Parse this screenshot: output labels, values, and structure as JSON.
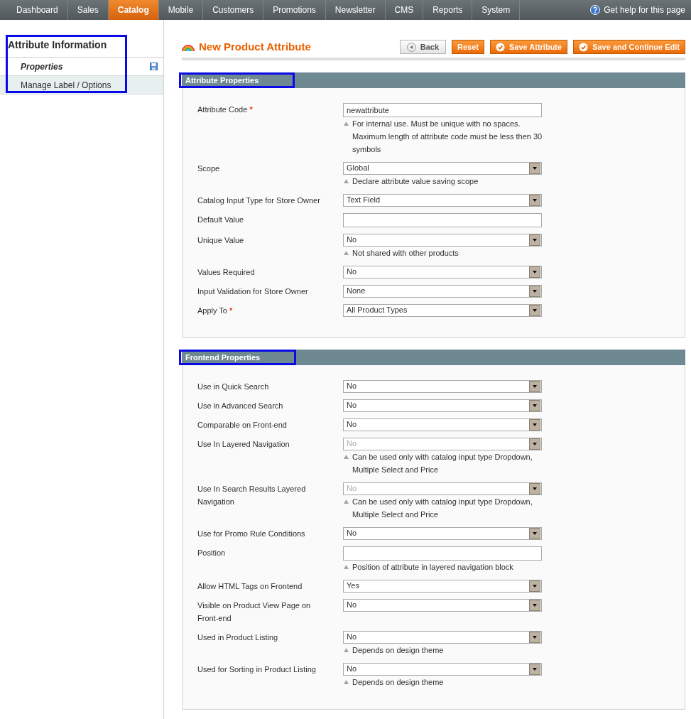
{
  "nav": {
    "items": [
      {
        "label": "Dashboard",
        "selected": false
      },
      {
        "label": "Sales",
        "selected": false
      },
      {
        "label": "Catalog",
        "selected": true
      },
      {
        "label": "Mobile",
        "selected": false
      },
      {
        "label": "Customers",
        "selected": false
      },
      {
        "label": "Promotions",
        "selected": false
      },
      {
        "label": "Newsletter",
        "selected": false
      },
      {
        "label": "CMS",
        "selected": false
      },
      {
        "label": "Reports",
        "selected": false
      },
      {
        "label": "System",
        "selected": false
      }
    ],
    "help": "Get help for this page"
  },
  "sidebar": {
    "title": "Attribute Information",
    "highlighted": true,
    "tabs": [
      {
        "label": "Properties",
        "selected": true
      },
      {
        "label": "Manage Label / Options",
        "selected": false
      }
    ]
  },
  "page_title": "New Product Attribute",
  "buttons": [
    {
      "label": "Back",
      "kind": "back"
    },
    {
      "label": "Reset",
      "kind": "plain"
    },
    {
      "label": "Save Attribute",
      "kind": "save"
    },
    {
      "label": "Save and Continue Edit",
      "kind": "save"
    }
  ],
  "sections": [
    {
      "title": "Attribute Properties",
      "highlighted": true,
      "fields": [
        {
          "label": "Attribute Code",
          "marker": "*",
          "kind": "text",
          "value": "newattribute",
          "notes": [
            "For internal use. Must be unique with no spaces. Maximum length of attribute code must be less then 30 symbols"
          ]
        },
        {
          "label": "Scope",
          "kind": "select",
          "value": "Global",
          "disabled": false,
          "notes": [
            "Declare attribute value saving scope"
          ]
        },
        {
          "label": "Catalog Input Type for Store Owner",
          "kind": "select",
          "value": "Text Field",
          "disabled": false
        },
        {
          "label": "Default Value",
          "kind": "text"
        },
        {
          "label": "Unique Value",
          "kind": "select",
          "value": "No",
          "disabled": false,
          "notes": [
            "Not shared with other products"
          ]
        },
        {
          "label": "Values Required",
          "kind": "select",
          "value": "No",
          "disabled": false
        },
        {
          "label": "Input Validation for Store Owner",
          "kind": "select",
          "value": "None",
          "disabled": false
        },
        {
          "label": "Apply To",
          "marker": "*",
          "kind": "select",
          "value": "All Product Types",
          "disabled": false
        }
      ]
    },
    {
      "title": "Frontend Properties",
      "highlighted": true,
      "fields": [
        {
          "label": "Use in Quick Search",
          "kind": "select",
          "value": "No",
          "disabled": false
        },
        {
          "label": "Use in Advanced Search",
          "kind": "select",
          "value": "No",
          "disabled": false
        },
        {
          "label": "Comparable on Front-end",
          "kind": "select",
          "value": "No",
          "disabled": false
        },
        {
          "label": "Use In Layered Navigation",
          "kind": "select",
          "value": "No",
          "disabled": true,
          "notes": [
            "Can be used only with catalog input type Dropdown, Multiple Select and Price"
          ]
        },
        {
          "label": "Use In Search Results Layered Navigation",
          "kind": "select",
          "value": "No",
          "disabled": true,
          "notes": [
            "Can be used only with catalog input type Dropdown, Multiple Select and Price"
          ]
        },
        {
          "label": "Use for Promo Rule Conditions",
          "kind": "select",
          "value": "No",
          "disabled": false
        },
        {
          "label": "Position",
          "kind": "text",
          "notes": [
            "Position of attribute in layered navigation block"
          ]
        },
        {
          "label": "Allow HTML Tags on Frontend",
          "kind": "select",
          "value": "Yes",
          "disabled": false
        },
        {
          "label": "Visible on Product View Page on Front-end",
          "kind": "select",
          "value": "No",
          "disabled": false
        },
        {
          "label": "Used in Product Listing",
          "kind": "select",
          "value": "No",
          "disabled": false,
          "notes": [
            "Depends on design theme"
          ]
        },
        {
          "label": "Used for Sorting in Product Listing",
          "kind": "select",
          "value": "No",
          "disabled": false,
          "notes": [
            "Depends on design theme"
          ]
        }
      ]
    }
  ]
}
